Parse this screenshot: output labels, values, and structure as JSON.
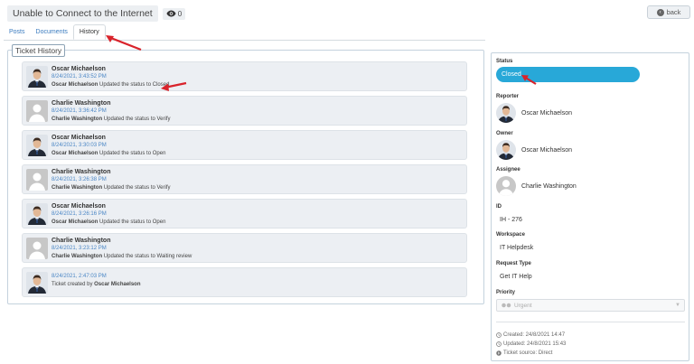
{
  "header": {
    "title": "Unable to Connect to the Internet",
    "views": "0",
    "back_label": "back"
  },
  "tabs": [
    {
      "label": "Posts"
    },
    {
      "label": "Documents"
    },
    {
      "label": "History"
    }
  ],
  "history": {
    "legend": "Ticket History",
    "entries": [
      {
        "name": "Oscar Michaelson",
        "date": "8/24/2021, 3:43:52 PM",
        "actor": "Oscar Michaelson",
        "action": " Updated the status to Closed",
        "avatar": "photo"
      },
      {
        "name": "Charlie Washington",
        "date": "8/24/2021, 3:36:42 PM",
        "actor": "Charlie Washington",
        "action": " Updated the status to Verify",
        "avatar": "placeholder"
      },
      {
        "name": "Oscar Michaelson",
        "date": "8/24/2021, 3:30:03 PM",
        "actor": "Oscar Michaelson",
        "action": " Updated the status to Open",
        "avatar": "photo"
      },
      {
        "name": "Charlie Washington",
        "date": "8/24/2021, 3:26:38 PM",
        "actor": "Charlie Washington",
        "action": " Updated the status to Verify",
        "avatar": "placeholder"
      },
      {
        "name": "Oscar Michaelson",
        "date": "8/24/2021, 3:26:16 PM",
        "actor": "Oscar Michaelson",
        "action": " Updated the status to Open",
        "avatar": "photo"
      },
      {
        "name": "Charlie Washington",
        "date": "8/24/2021, 3:23:12 PM",
        "actor": "Charlie Washington",
        "action": " Updated the status to Waiting review",
        "avatar": "placeholder"
      },
      {
        "name": "",
        "date": "8/24/2021, 2:47:03 PM",
        "prefix": "Ticket created by ",
        "actor": "Oscar Michaelson",
        "avatar": "photo"
      }
    ]
  },
  "sidebar": {
    "status_label": "Status",
    "status_value": "Closed",
    "reporter_label": "Reporter",
    "reporter_name": "Oscar Michaelson",
    "owner_label": "Owner",
    "owner_name": "Oscar Michaelson",
    "assignee_label": "Assignee",
    "assignee_name": "Charlie Washington",
    "id_label": "ID",
    "id_value": "IH - 276",
    "workspace_label": "Workspace",
    "workspace_value": "IT Helpdesk",
    "request_type_label": "Request Type",
    "request_type_value": "Get IT Help",
    "priority_label": "Priority",
    "priority_value": "Urgent",
    "created": "Created: 24/8/2021 14:47",
    "updated": "Updated: 24/8/2021 15:43",
    "source": "Ticket source:  Direct"
  },
  "colors": {
    "status_pill": "#28a8d8",
    "link_blue": "#4a86c5",
    "annotation_arrow": "#d9232b"
  }
}
